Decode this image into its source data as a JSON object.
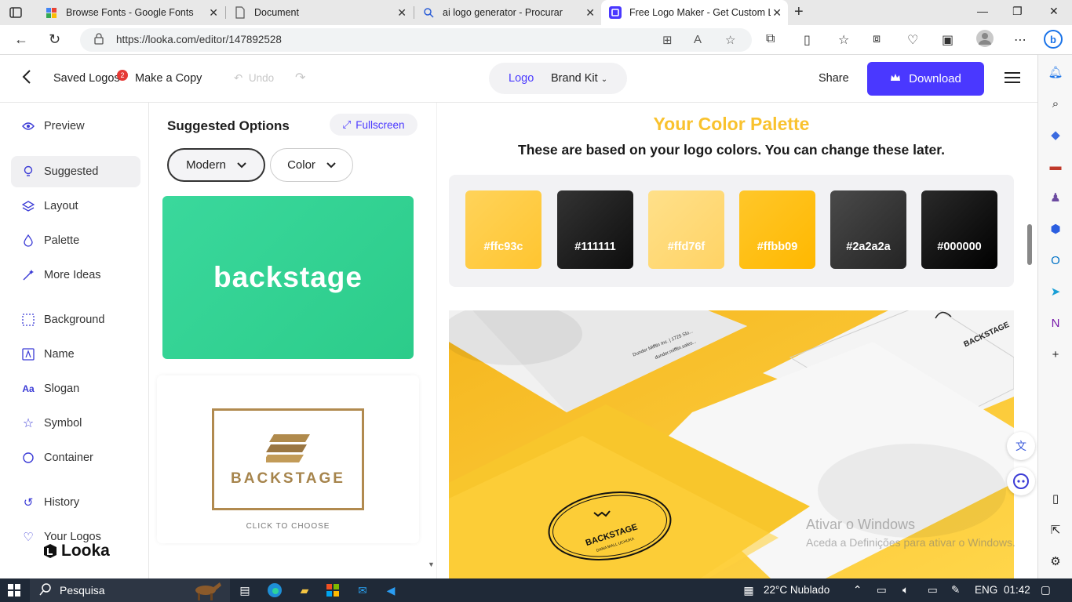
{
  "browser": {
    "tabs": [
      {
        "title": "Browse Fonts - Google Fonts",
        "active": false
      },
      {
        "title": "Document",
        "active": false
      },
      {
        "title": "ai logo generator - Procurar",
        "active": false
      },
      {
        "title": "Free Logo Maker - Get Custom L",
        "active": true
      }
    ],
    "url": "https://looka.com/editor/147892528"
  },
  "header": {
    "saved_logos": "Saved Logos",
    "saved_badge": "2",
    "make_copy": "Make a Copy",
    "undo": "Undo",
    "toggle_logo": "Logo",
    "toggle_brand_kit": "Brand Kit",
    "share": "Share",
    "download": "Download"
  },
  "sidebar": {
    "items": [
      {
        "label": "Preview",
        "icon": "eye-icon"
      },
      {
        "label": "Suggested",
        "icon": "lightbulb-icon",
        "active": true
      },
      {
        "label": "Layout",
        "icon": "layers-icon"
      },
      {
        "label": "Palette",
        "icon": "droplet-icon"
      },
      {
        "label": "More Ideas",
        "icon": "wand-icon"
      },
      {
        "label": "Background",
        "icon": "background-icon"
      },
      {
        "label": "Name",
        "icon": "name-icon"
      },
      {
        "label": "Slogan",
        "icon": "slogan-icon"
      },
      {
        "label": "Symbol",
        "icon": "star-icon"
      },
      {
        "label": "Container",
        "icon": "circle-icon"
      },
      {
        "label": "History",
        "icon": "history-icon"
      },
      {
        "label": "Your Logos",
        "icon": "heart-icon"
      }
    ],
    "brand": "Looka"
  },
  "options": {
    "title": "Suggested Options",
    "fullscreen": "Fullscreen",
    "style_dropdown": "Modern",
    "color_dropdown": "Color",
    "card1_text": "backstage",
    "card2_text": "BACKSTAGE",
    "card2_caption": "CLICK TO CHOOSE"
  },
  "palette": {
    "title": "Your Color Palette",
    "subtitle": "These are based on your logo colors. You can change these later.",
    "colors": [
      {
        "hex": "#ffc93c",
        "label": "#ffc93c"
      },
      {
        "hex": "#111111",
        "label": "#111111"
      },
      {
        "hex": "#ffd76f",
        "label": "#ffd76f"
      },
      {
        "hex": "#ffbb09",
        "label": "#ffbb09"
      },
      {
        "hex": "#2a2a2a",
        "label": "#2a2a2a"
      },
      {
        "hex": "#000000",
        "label": "#000000"
      }
    ]
  },
  "mockup": {
    "emblem_text": "BACKSTAGE",
    "emblem_sub": "DANA MALL UCHUKA",
    "corner_text": "BACKSTAGE",
    "address_text": "Dunder Mifflin Inc. | 1725 Slo...",
    "address_text2": "dunder.mifflin.sales..."
  },
  "watermark": {
    "line1": "Ativar o Windows",
    "line2": "Aceda a Definições para ativar o Windows."
  },
  "taskbar": {
    "search": "Pesquisa",
    "weather": "22°C  Nublado",
    "lang": "ENG",
    "time": "01:42"
  }
}
